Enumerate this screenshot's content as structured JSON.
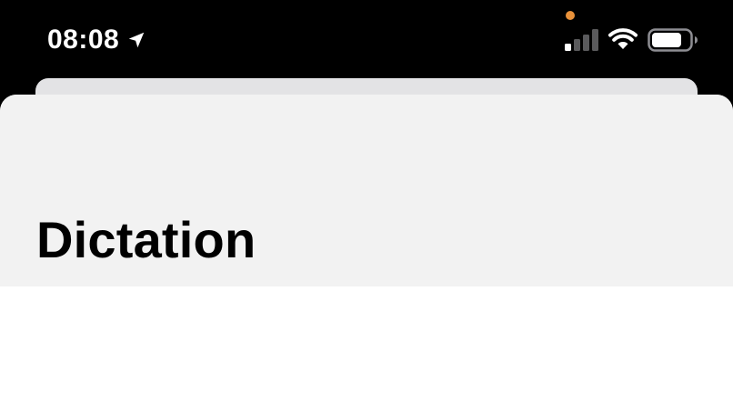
{
  "status_bar": {
    "time": "08:08",
    "location_icon": "location-arrow-icon",
    "privacy_indicator_color": "#e8913a",
    "signal_icon": "cellular-signal-icon",
    "signal_bars_active": 1,
    "signal_bars_total": 4,
    "wifi_icon": "wifi-icon",
    "battery_icon": "battery-icon",
    "battery_level": 0.8
  },
  "sheet": {
    "title": "Dictation"
  },
  "colors": {
    "background": "#000000",
    "sheet_behind": "#e3e3e5",
    "nav_background": "#f2f2f2",
    "content_background": "#ffffff",
    "text_primary": "#000000",
    "status_text": "#ffffff",
    "signal_inactive": "#5a5a5c"
  }
}
